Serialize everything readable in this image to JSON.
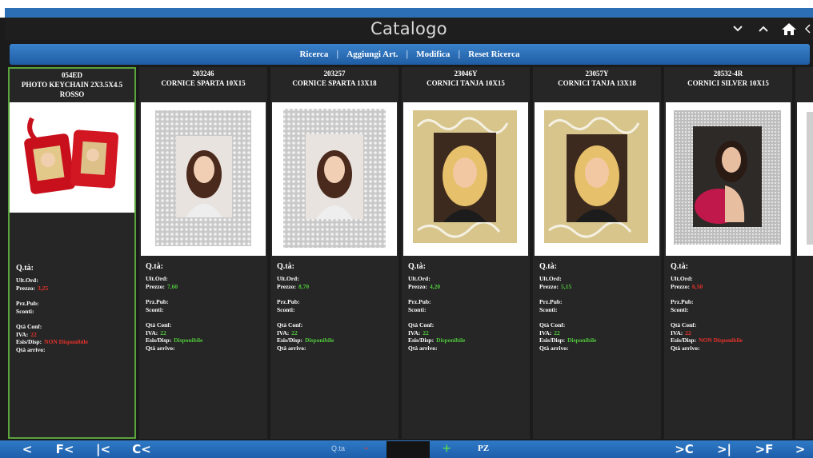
{
  "window": {
    "title": "Catalogo"
  },
  "toolbar": {
    "buttons": [
      "Ricerca",
      "Aggiungi Art.",
      "Modifica",
      "Reset Ricerca"
    ]
  },
  "labels": {
    "qta": "Q.tà:",
    "ult_ord": "Ult.Ord:",
    "prezzo": "Prezzo:",
    "prz_pub": "Prz.Pub:",
    "sconti": "Sconti:",
    "qta_conf": "Qtà Conf:",
    "iva": "IVA:",
    "esis_disp": "Esis/Disp:",
    "qta_arrivo": "Qtà arrivo:"
  },
  "products": [
    {
      "code": "054ED",
      "name": "PHOTO KEYCHAIN 2X3.5X4.5 ROSSO",
      "prezzo": "3,25",
      "iva": "22",
      "disponibilita": "NON Disponibile",
      "available": false,
      "selected": true
    },
    {
      "code": "203246",
      "name": "CORNICE SPARTA 10X15",
      "prezzo": "7,60",
      "iva": "22",
      "disponibilita": "Disponibile",
      "available": true,
      "selected": false
    },
    {
      "code": "203257",
      "name": "CORNICE SPARTA 13X18",
      "prezzo": "8,70",
      "iva": "22",
      "disponibilita": "Disponibile",
      "available": true,
      "selected": false
    },
    {
      "code": "23046Y",
      "name": "CORNICI TANJA 10X15",
      "prezzo": "4,20",
      "iva": "22",
      "disponibilita": "Disponibile",
      "available": true,
      "selected": false
    },
    {
      "code": "23057Y",
      "name": "CORNICI TANJA 13X18",
      "prezzo": "5,15",
      "iva": "22",
      "disponibilita": "Disponibile",
      "available": true,
      "selected": false
    },
    {
      "code": "28532-4R",
      "name": "CORNICI SILVER 10X15",
      "prezzo": "6,50",
      "iva": "22",
      "disponibilita": "NON Disponibile",
      "available": false,
      "selected": false
    }
  ],
  "footer": {
    "prev": "<",
    "first": "F<",
    "prev_page": "|<",
    "prev_cat": "C<",
    "qta_label": "Q.ta",
    "minus": "-",
    "qty_value": "",
    "plus": "+",
    "unit": "PZ",
    "next_cat": ">C",
    "next_page": ">|",
    "last": ">F",
    "next": ">"
  },
  "colors": {
    "accent_blue": "#2d6fb4",
    "available": "#4fc83a",
    "unavailable": "#e8322a",
    "selected_border": "#5aa43c"
  }
}
